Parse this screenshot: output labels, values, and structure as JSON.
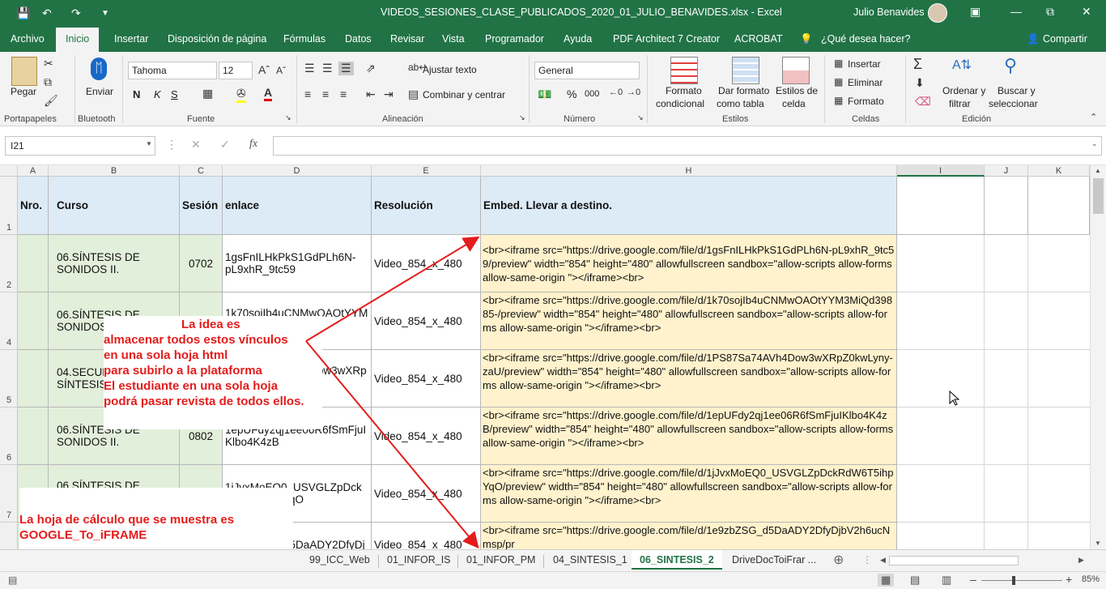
{
  "titlebar": {
    "title": "VIDEOS_SESIONES_CLASE_PUBLICADOS_2020_01_JULIO_BENAVIDES.xlsx  -  Excel",
    "user": "Julio Benavides"
  },
  "menu_tabs": [
    "Archivo",
    "Inicio",
    "Insertar",
    "Disposición de página",
    "Fórmulas",
    "Datos",
    "Revisar",
    "Vista",
    "Programador",
    "Ayuda",
    "PDF Architect 7 Creator",
    "ACROBAT",
    "¿Qué desea hacer?",
    "Compartir"
  ],
  "ribbon": {
    "portapapeles": {
      "pegar": "Pegar",
      "group": "Portapapeles"
    },
    "bluetooth": {
      "enviar": "Enviar",
      "group": "Bluetooth"
    },
    "fuente": {
      "font_name": "Tahoma",
      "font_size": "12",
      "bold": "N",
      "italic": "K",
      "underline": "S",
      "group": "Fuente"
    },
    "alineacion": {
      "ajustar": "Ajustar texto",
      "combinar": "Combinar y centrar",
      "group": "Alineación"
    },
    "numero": {
      "format": "General",
      "percent": "%",
      "thousands": "000",
      "group": "Número"
    },
    "estilos": {
      "formato_cond_1": "Formato",
      "formato_cond_2": "condicional",
      "dar_formato_1": "Dar formato",
      "dar_formato_2": "como tabla",
      "estilos_celda_1": "Estilos de",
      "estilos_celda_2": "celda",
      "group": "Estilos"
    },
    "celdas": {
      "insertar": "Insertar",
      "eliminar": "Eliminar",
      "formato": "Formato",
      "group": "Celdas"
    },
    "edicion": {
      "ordenar_1": "Ordenar y",
      "ordenar_2": "filtrar",
      "buscar_1": "Buscar y",
      "buscar_2": "seleccionar",
      "group": "Edición"
    }
  },
  "formula_bar": {
    "name_box": "I21",
    "fx": "fx",
    "formula": ""
  },
  "columns": [
    "A",
    "B",
    "C",
    "D",
    "E",
    "H",
    "I",
    "J",
    "K"
  ],
  "rows": [
    {
      "num": "1",
      "a": "Nro.",
      "b": "Curso",
      "c": "Sesión",
      "d": "enlace",
      "e": "Resolución",
      "h": "Embed. Llevar a destino."
    },
    {
      "num": "2",
      "a": "",
      "b": "06.SÍNTESIS DE SONIDOS II.",
      "c": "0702",
      "d": "1gsFnILHkPkS1GdPLh6N-pL9xhR_9tc59",
      "e": "Video_854_x_480",
      "h": "<br><iframe src=\"https://drive.google.com/file/d/1gsFnILHkPkS1GdPLh6N-pL9xhR_9tc59/preview\" width=\"854\" height=\"480\" allowfullscreen sandbox=\"allow-scripts allow-forms allow-same-origin \"></iframe><br>"
    },
    {
      "num": "4",
      "a": "",
      "b": "06.SÍNTESIS DE SONIDOS II.",
      "c": "",
      "d": "1k70sojIb4uCNMwOAOtYYM",
      "e": "Video_854_x_480",
      "h": "<br><iframe src=\"https://drive.google.com/file/d/1k70sojIb4uCNMwOAOtYYM3MiQd39885-/preview\" width=\"854\" height=\"480\" allowfullscreen sandbox=\"allow-scripts allow-forms allow-same-origin \"></iframe><br>"
    },
    {
      "num": "5",
      "a": "",
      "b": "04.SECUENCIAS DE SÍNTESIS",
      "c": "",
      "d": "1PS87Sa74AVh4Dow3wXRp",
      "e": "Video_854_x_480",
      "h": "<br><iframe src=\"https://drive.google.com/file/d/1PS87Sa74AVh4Dow3wXRpZ0kwLyny-zaU/preview\" width=\"854\" height=\"480\" allowfullscreen sandbox=\"allow-scripts allow-forms allow-same-origin \"></iframe><br>"
    },
    {
      "num": "6",
      "a": "",
      "b": "06.SÍNTESIS DE SONIDOS II.",
      "c": "0802",
      "d": "1epUFdy2qj1ee06R6fSmFjuIKlbo4K4zB",
      "e": "Video_854_x_480",
      "h": "<br><iframe src=\"https://drive.google.com/file/d/1epUFdy2qj1ee06R6fSmFjuIKlbo4K4zB/preview\" width=\"854\" height=\"480\" allowfullscreen sandbox=\"allow-scripts allow-forms allow-same-origin \"></iframe><br>"
    },
    {
      "num": "7",
      "a": "",
      "b": "06.SÍNTESIS DE",
      "c": "",
      "d": "1jJvxMoEQ0_USVGLZpDckRdW6T5ihpYqO",
      "e": "Video_854_x_480",
      "h": "<br><iframe src=\"https://drive.google.com/file/d/1jJvxMoEQ0_USVGLZpDckRdW6T5ihpYqO/preview\" width=\"854\" height=\"480\" allowfullscreen sandbox=\"allow-scripts allow-forms allow-same-origin \"></iframe><br>"
    },
    {
      "num": "",
      "a": "",
      "b": "",
      "c": "",
      "d": "1e9zbZSG_d5DaADY2DfyDj",
      "e": "Video_854_x_480",
      "h": "<br><iframe src=\"https://drive.google.com/file/d/1e9zbZSG_d5DaADY2DfyDjbV2h6ucNmsp/pr"
    }
  ],
  "notes": {
    "idea": [
      "La idea es",
      "almacenar todos estos vínculos",
      "en una sola hoja html",
      "para subirlo a la plataforma",
      "El estudiante en una sola hoja",
      "podrá pasar revista de todos ellos."
    ],
    "hoja": [
      "La hoja de cálculo que se muestra es",
      "GOOGLE_To_iFRAME"
    ]
  },
  "sheet_tabs": [
    "99_ICC_Web",
    "01_INFOR_IS",
    "01_INFOR_PM",
    "04_SINTESIS_1",
    "06_SINTESIS_2",
    "DriveDocToiFrar ..."
  ],
  "active_sheet": "06_SINTESIS_2",
  "status": {
    "zoom": "85%"
  },
  "colors": {
    "excel_green": "#217346",
    "header_fill": "#ddebf7",
    "green_fill": "#e2efda",
    "yellow_fill": "#fff2cc",
    "annotation_red": "#e51c1c"
  }
}
